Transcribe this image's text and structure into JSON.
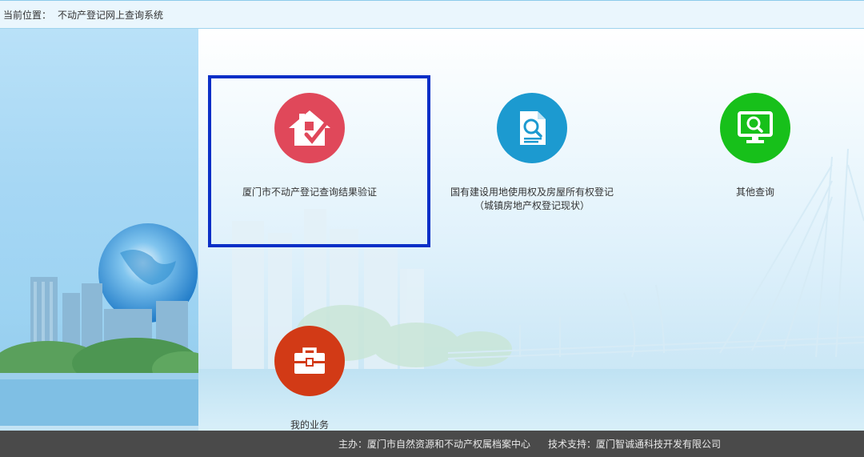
{
  "breadcrumb": {
    "label": "当前位置：",
    "current": "不动产登记网上查询系统"
  },
  "cards": [
    {
      "label": "厦门市不动产登记查询结果验证",
      "icon": "house-check-icon",
      "color": "#e0485a"
    },
    {
      "label": "国有建设用地使用权及房屋所有权登记",
      "label2": "（城镇房地产权登记现状）",
      "icon": "document-search-icon",
      "color": "#1c9ad0"
    },
    {
      "label": "其他查询",
      "icon": "monitor-search-icon",
      "color": "#17c01a"
    },
    {
      "label": "我的业务",
      "icon": "briefcase-icon",
      "color": "#d23a16"
    }
  ],
  "footer": {
    "host": "主办：厦门市自然资源和不动产权属档案中心",
    "support": "技术支持：厦门智诚通科技开发有限公司"
  }
}
